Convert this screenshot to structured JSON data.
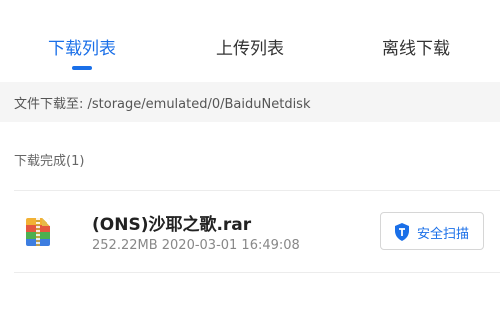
{
  "tabs": [
    {
      "label": "下载列表",
      "active": true
    },
    {
      "label": "上传列表",
      "active": false
    },
    {
      "label": "离线下载",
      "active": false
    }
  ],
  "download_path": {
    "text": "文件下载至: /storage/emulated/0/BaiduNetdisk"
  },
  "section": {
    "title": "下载完成(1)"
  },
  "files": [
    {
      "name": "(ONS)沙耶之歌.rar",
      "meta": "252.22MB 2020-03-01 16:49:08",
      "icon": "rar-archive-icon",
      "action_label": "安全扫描",
      "action_icon": "shield-icon"
    }
  ],
  "colors": {
    "accent": "#1a6fe8",
    "background": "#f5f5f5"
  }
}
